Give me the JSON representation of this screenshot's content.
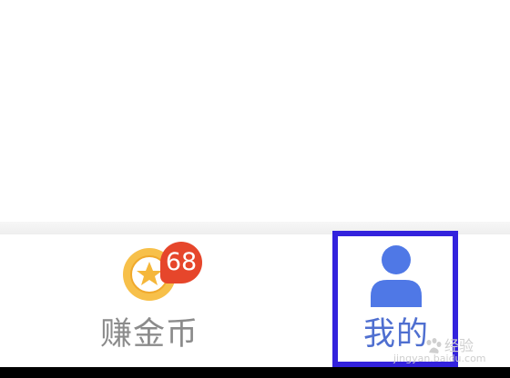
{
  "tabbar": {
    "tabs": [
      {
        "label": "赚金币",
        "icon": "coin-star-icon",
        "badge": "68",
        "active": false
      },
      {
        "label": "我的",
        "icon": "person-icon",
        "active": true
      }
    ]
  },
  "watermark": {
    "text": "经验",
    "url": "jingyan.baidu.com"
  },
  "colors": {
    "active_tab": "#4f6fd0",
    "inactive_tab": "#8b8b8b",
    "badge": "#e6462b",
    "coin": "#f5b73a",
    "highlight_box": "#3322dd"
  }
}
